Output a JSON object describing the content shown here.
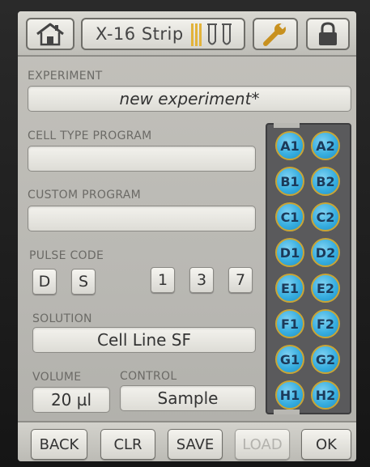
{
  "toolbar": {
    "strip_label": "X-16 Strip",
    "home_icon": "home-icon",
    "wrench_icon": "wrench-icon",
    "lock_icon": "lock-icon"
  },
  "experiment": {
    "label": "EXPERIMENT",
    "value": "new experiment*"
  },
  "cell_type_program": {
    "label": "CELL TYPE PROGRAM",
    "value": ""
  },
  "custom_program": {
    "label": "CUSTOM PROGRAM",
    "value": ""
  },
  "pulse_code": {
    "label": "PULSE CODE",
    "codes": [
      "D",
      "S",
      "1",
      "3",
      "7"
    ]
  },
  "solution": {
    "label": "SOLUTION",
    "value": "Cell Line SF"
  },
  "volume": {
    "label": "VOLUME",
    "value": "20 µl"
  },
  "control": {
    "label": "CONTROL",
    "value": "Sample"
  },
  "wells": [
    [
      "A1",
      "A2"
    ],
    [
      "B1",
      "B2"
    ],
    [
      "C1",
      "C2"
    ],
    [
      "D1",
      "D2"
    ],
    [
      "E1",
      "E2"
    ],
    [
      "F1",
      "F2"
    ],
    [
      "G1",
      "G2"
    ],
    [
      "H1",
      "H2"
    ]
  ],
  "bottom": {
    "back": "BACK",
    "clr": "CLR",
    "save": "SAVE",
    "load": "LOAD",
    "ok": "OK"
  },
  "colors": {
    "well_fill": "#38aee0",
    "well_border": "#c9a535",
    "plate": "#5a5a5c",
    "screen_bg": "#bdbcb6"
  }
}
